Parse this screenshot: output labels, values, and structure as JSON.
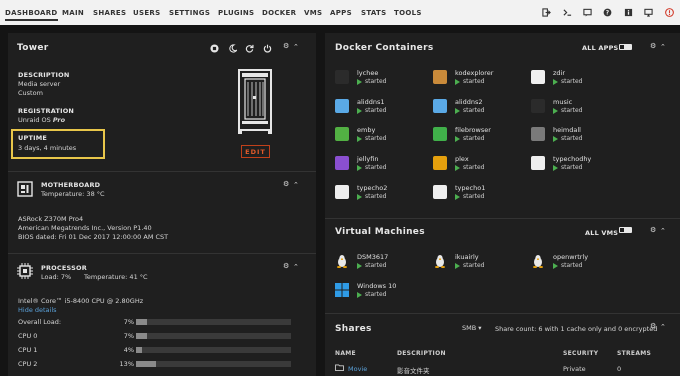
{
  "nav": {
    "items": [
      "DASHBOARD",
      "MAIN",
      "SHARES",
      "USERS",
      "SETTINGS",
      "PLUGINS",
      "DOCKER",
      "VMS",
      "APPS",
      "STATS",
      "TOOLS"
    ],
    "icons": [
      "logout-icon",
      "terminal-icon",
      "feedback-icon",
      "help-icon",
      "info-icon",
      "monitor-icon",
      "notification-icon"
    ]
  },
  "tower": {
    "title": "Tower",
    "description_label": "DESCRIPTION",
    "description_line1": "Media server",
    "description_line2": "Custom",
    "registration_label": "REGISTRATION",
    "registration_prefix": "Unraid OS ",
    "registration_tier": "Pro",
    "uptime_label": "UPTIME",
    "uptime_value": "3 days, 4 minutes",
    "edit_label": "EDIT"
  },
  "motherboard": {
    "title": "MOTHERBOARD",
    "temperature": "Temperature: 38 °C",
    "model": "ASRock Z370M Pro4",
    "bios_vendor": "American Megatrends Inc., Version P1.40",
    "bios_dated": "BIOS dated: Fri 01 Dec 2017 12:00:00 AM CST"
  },
  "processor": {
    "title": "PROCESSOR",
    "load": "Load: 7%",
    "temperature": "Temperature: 41 °C",
    "model": "Intel® Core™ i5-8400 CPU @ 2.80GHz",
    "hide_details": "Hide details",
    "rows": [
      {
        "label": "Overall Load:",
        "value": "7%",
        "fraction": 0.07
      },
      {
        "label": "CPU 0",
        "value": "7%",
        "fraction": 0.07
      },
      {
        "label": "CPU 1",
        "value": "4%",
        "fraction": 0.04
      },
      {
        "label": "CPU 2",
        "value": "13%",
        "fraction": 0.13
      }
    ]
  },
  "docker": {
    "title": "Docker Containers",
    "all_apps": "ALL APPS",
    "containers": [
      {
        "name": "lychee",
        "state": "started",
        "color": "#2b2b2b"
      },
      {
        "name": "kodexplorer",
        "state": "started",
        "color": "#c98a3a"
      },
      {
        "name": "zdir",
        "state": "started",
        "color": "#f0f0f0"
      },
      {
        "name": "aliddns1",
        "state": "started",
        "color": "#5aa9e6"
      },
      {
        "name": "aliddns2",
        "state": "started",
        "color": "#5aa9e6"
      },
      {
        "name": "music",
        "state": "started",
        "color": "#2b2b2b"
      },
      {
        "name": "emby",
        "state": "started",
        "color": "#52b043"
      },
      {
        "name": "filebrowser",
        "state": "started",
        "color": "#40b04a"
      },
      {
        "name": "heimdall",
        "state": "started",
        "color": "#7a7a7a"
      },
      {
        "name": "jellyfin",
        "state": "started",
        "color": "#8a4fd0"
      },
      {
        "name": "plex",
        "state": "started",
        "color": "#e5a00d"
      },
      {
        "name": "typechodhy",
        "state": "started",
        "color": "#eeeeee"
      },
      {
        "name": "typecho2",
        "state": "started",
        "color": "#eeeeee"
      },
      {
        "name": "typecho1",
        "state": "started",
        "color": "#eeeeee"
      }
    ]
  },
  "vms": {
    "title": "Virtual Machines",
    "all_vms": "ALL VMS",
    "items": [
      {
        "name": "DSM3617",
        "state": "started",
        "icon": "linux-icon"
      },
      {
        "name": "ikuairly",
        "state": "started",
        "icon": "linux-icon"
      },
      {
        "name": "openwrtrly",
        "state": "started",
        "icon": "linux-icon"
      },
      {
        "name": "Windows 10",
        "state": "started",
        "icon": "windows-icon"
      }
    ]
  },
  "shares": {
    "title": "Shares",
    "filter": "SMB",
    "summary": "Share count: 6 with 1 cache only and 0 encrypted",
    "headers": [
      "NAME",
      "DESCRIPTION",
      "SECURITY",
      "STREAMS"
    ],
    "rows": [
      {
        "name": "Movie",
        "description": "影音文件夹",
        "security": "Private",
        "streams": "0"
      }
    ]
  }
}
